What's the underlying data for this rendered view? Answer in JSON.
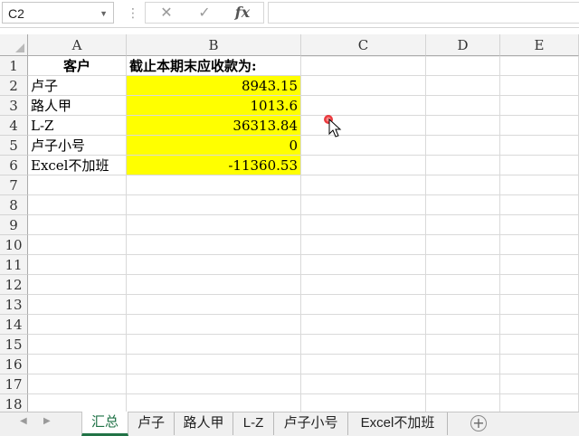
{
  "formula_bar": {
    "name_box": "C2",
    "cancel_icon": "✕",
    "enter_icon": "✓",
    "fx_label": "fx",
    "formula": ""
  },
  "columns": [
    "A",
    "B",
    "C",
    "D",
    "E"
  ],
  "rows": [
    "1",
    "2",
    "3",
    "4",
    "5",
    "6",
    "7",
    "8",
    "9",
    "10",
    "11",
    "12",
    "13",
    "14",
    "15",
    "16",
    "17",
    "18"
  ],
  "cells": {
    "A1": "客户",
    "B1": "截止本期末应收款为:",
    "A2": "卢子",
    "B2": "8943.15",
    "A3": "路人甲",
    "B3": "1013.6",
    "A4": "L-Z",
    "B4": "36313.84",
    "A5": "卢子小号",
    "B5": "0",
    "A6": "Excel不加班",
    "B6": "-11360.53"
  },
  "sheet_tabs": [
    "汇总",
    "卢子",
    "路人甲",
    "L-Z",
    "卢子小号",
    "Excel不加班"
  ],
  "active_sheet": "汇总",
  "add_sheet": "+",
  "colors": {
    "highlight": "#ffff00",
    "active_tab": "#217346"
  }
}
